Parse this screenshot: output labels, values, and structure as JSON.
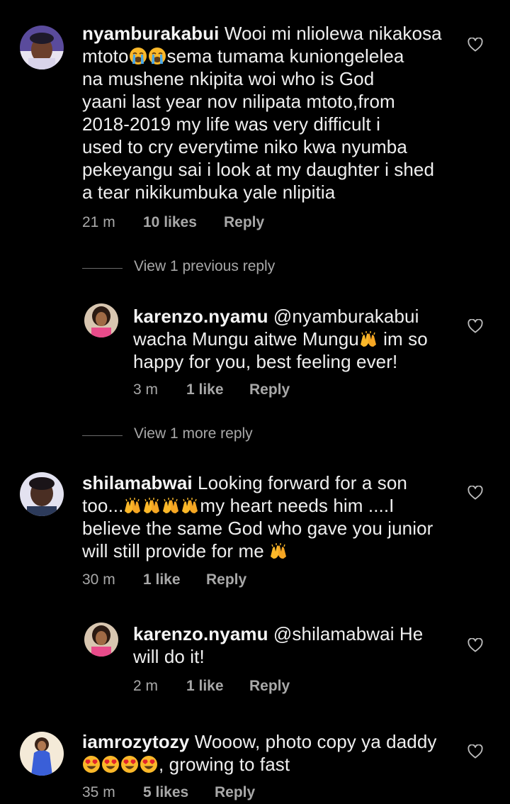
{
  "comments": [
    {
      "username": "nyamburakabui",
      "text_lines": [
        "Wooi mi nliolewa nikakosa",
        "mtoto",
        "sema tumama kuniongelelea",
        "na mushene nkipita woi who is God",
        "yaani last year nov nilipata mtoto,from",
        "2018-2019 my life was very difficult i",
        "used to cry everytime niko kwa nyumba",
        "pekeyangu sai i look at my daughter i shed",
        "a tear nikikumbuka yale  nlipitia"
      ],
      "time": "21 m",
      "likes": "10 likes",
      "reply": "Reply"
    },
    {
      "view_more": "View 1 previous reply"
    },
    {
      "username": "karenzo.nyamu",
      "text_lines": [
        "@nyamburakabui",
        "wacha Mungu aitwe Mungu",
        " im so",
        "happy for you, best feeling ever!"
      ],
      "time": "3 m",
      "likes": "1 like",
      "reply": "Reply"
    },
    {
      "view_more": "View 1 more reply"
    },
    {
      "username": "shilamabwai",
      "text_lines": [
        "Looking forward for a son",
        "too...",
        "my heart needs him ....I",
        "believe the same God who gave you junior",
        "will still provide for me"
      ],
      "time": "30 m",
      "likes": "1 like",
      "reply": "Reply"
    },
    {
      "username": "karenzo.nyamu",
      "text_lines": [
        "@shilamabwai He",
        "will do it!"
      ],
      "time": "2 m",
      "likes": "1 like",
      "reply": "Reply"
    },
    {
      "username": "iamrozytozy",
      "text_lines": [
        "Wooow, photo copy ya daddy",
        ", growing to fast"
      ],
      "time": "35 m",
      "likes": "5 likes",
      "reply": "Reply"
    }
  ],
  "icons": {
    "like": "heart-outline-icon",
    "crying": "crying-face-emoji",
    "raised_hands": "raising-hands-emoji",
    "heart_eyes": "heart-eyes-emoji"
  },
  "colors": {
    "background": "#000000",
    "text": "#f2f2f2",
    "meta": "#a8a8a8",
    "emoji_yellow": "#fbb829"
  }
}
